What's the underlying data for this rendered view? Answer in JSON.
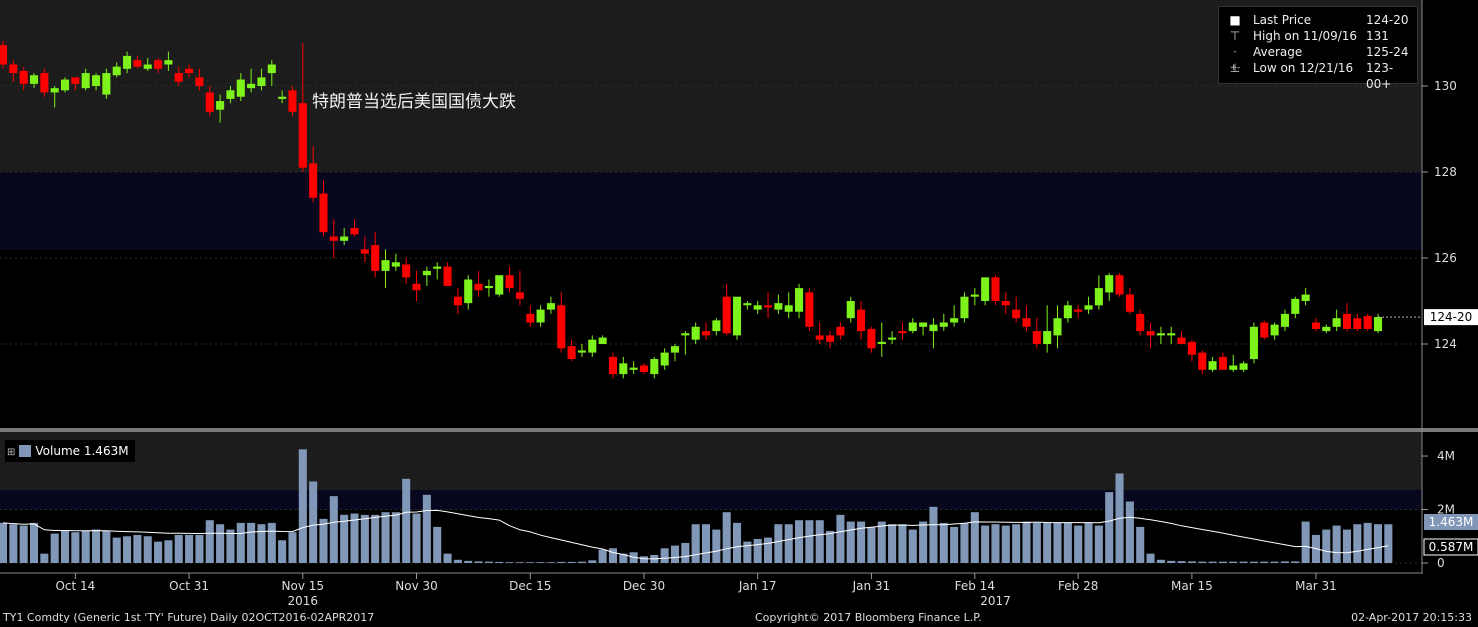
{
  "chart_data": [
    {
      "type": "candlestick",
      "instrument": "TY1 Comdty",
      "annotation": "特朗普当选后美国国债大跌",
      "ylim": [
        122,
        132
      ],
      "yticks": [
        124,
        126,
        128,
        130
      ],
      "ytick_labels": [
        "124",
        "126",
        "128",
        "130"
      ],
      "last_price_tag": "124-20",
      "last_price_value": 124.625,
      "legend": [
        {
          "symbol": "■",
          "label": "Last Price",
          "value": "124-20"
        },
        {
          "symbol": "⊤",
          "label": "High on 11/09/16",
          "value": "131"
        },
        {
          "symbol": "-+-",
          "label": "Average",
          "value": "125-24"
        },
        {
          "symbol": "⊥",
          "label": "Low on 12/21/16",
          "value": "123-00+"
        }
      ],
      "colors": {
        "up": "#7ef21b",
        "down": "#ff0000"
      },
      "candles": [
        [
          130.95,
          131.05,
          130.4,
          130.5
        ],
        [
          130.5,
          130.6,
          130.1,
          130.3
        ],
        [
          130.35,
          130.45,
          129.9,
          130.05
        ],
        [
          130.05,
          130.3,
          129.95,
          130.25
        ],
        [
          130.3,
          130.4,
          129.75,
          129.85
        ],
        [
          129.85,
          130.0,
          129.5,
          129.95
        ],
        [
          129.9,
          130.2,
          129.85,
          130.15
        ],
        [
          130.2,
          130.2,
          129.9,
          130.05
        ],
        [
          129.95,
          130.4,
          129.9,
          130.3
        ],
        [
          130.0,
          130.3,
          129.9,
          130.25
        ],
        [
          129.8,
          130.4,
          129.7,
          130.3
        ],
        [
          130.25,
          130.55,
          130.2,
          130.45
        ],
        [
          130.4,
          130.8,
          130.3,
          130.7
        ],
        [
          130.6,
          130.7,
          130.4,
          130.45
        ],
        [
          130.4,
          130.65,
          130.35,
          130.5
        ],
        [
          130.6,
          130.65,
          130.3,
          130.4
        ],
        [
          130.5,
          130.8,
          130.35,
          130.6
        ],
        [
          130.3,
          130.45,
          130.0,
          130.1
        ],
        [
          130.4,
          130.5,
          130.2,
          130.3
        ],
        [
          130.2,
          130.4,
          129.9,
          130.0
        ],
        [
          129.85,
          130.0,
          129.3,
          129.4
        ],
        [
          129.45,
          129.8,
          129.15,
          129.65
        ],
        [
          129.7,
          130.0,
          129.6,
          129.9
        ],
        [
          129.75,
          130.3,
          129.65,
          130.15
        ],
        [
          129.95,
          130.4,
          129.85,
          130.05
        ],
        [
          130.0,
          130.4,
          129.9,
          130.2
        ],
        [
          130.3,
          130.6,
          130.0,
          130.5
        ],
        [
          129.7,
          129.9,
          129.6,
          129.75
        ],
        [
          129.9,
          130.0,
          129.3,
          129.4
        ],
        [
          129.6,
          131.0,
          128.0,
          128.1
        ],
        [
          128.2,
          128.6,
          127.3,
          127.4
        ],
        [
          127.5,
          127.8,
          126.5,
          126.6
        ],
        [
          126.5,
          126.9,
          126.0,
          126.4
        ],
        [
          126.4,
          126.7,
          126.3,
          126.5
        ],
        [
          126.7,
          126.9,
          126.5,
          126.55
        ],
        [
          126.2,
          126.5,
          125.9,
          126.1
        ],
        [
          126.3,
          126.6,
          125.55,
          125.7
        ],
        [
          125.7,
          126.2,
          125.3,
          125.95
        ],
        [
          125.8,
          126.1,
          125.7,
          125.9
        ],
        [
          125.85,
          126.0,
          125.4,
          125.55
        ],
        [
          125.4,
          125.7,
          125.0,
          125.25
        ],
        [
          125.6,
          125.8,
          125.35,
          125.7
        ],
        [
          125.75,
          125.9,
          125.5,
          125.8
        ],
        [
          125.8,
          125.9,
          125.35,
          125.35
        ],
        [
          125.1,
          125.3,
          124.7,
          124.9
        ],
        [
          124.95,
          125.6,
          124.8,
          125.5
        ],
        [
          125.4,
          125.7,
          125.1,
          125.25
        ],
        [
          125.3,
          125.5,
          125.1,
          125.35
        ],
        [
          125.15,
          125.5,
          125.1,
          125.6
        ],
        [
          125.6,
          125.8,
          125.2,
          125.3
        ],
        [
          125.2,
          125.7,
          124.9,
          125.05
        ],
        [
          124.7,
          124.9,
          124.4,
          124.5
        ],
        [
          124.5,
          124.9,
          124.4,
          124.8
        ],
        [
          124.8,
          125.1,
          124.7,
          124.95
        ],
        [
          124.9,
          125.2,
          123.8,
          123.9
        ],
        [
          123.95,
          124.1,
          123.6,
          123.65
        ],
        [
          123.8,
          124.0,
          123.7,
          123.85
        ],
        [
          123.8,
          124.2,
          123.7,
          124.1
        ],
        [
          124.0,
          124.2,
          124.0,
          124.15
        ],
        [
          123.7,
          123.8,
          123.2,
          123.3
        ],
        [
          123.3,
          123.7,
          123.2,
          123.55
        ],
        [
          123.4,
          123.6,
          123.3,
          123.45
        ],
        [
          123.5,
          123.55,
          123.3,
          123.35
        ],
        [
          123.3,
          123.7,
          123.2,
          123.65
        ],
        [
          123.5,
          123.9,
          123.4,
          123.8
        ],
        [
          123.8,
          124.0,
          123.6,
          123.95
        ],
        [
          124.2,
          124.3,
          123.75,
          124.25
        ],
        [
          124.1,
          124.5,
          124.0,
          124.4
        ],
        [
          124.3,
          124.5,
          124.1,
          124.2
        ],
        [
          124.3,
          124.6,
          124.2,
          124.55
        ],
        [
          125.1,
          125.4,
          124.2,
          124.25
        ],
        [
          124.2,
          125.0,
          124.1,
          125.1
        ],
        [
          124.9,
          125.0,
          124.8,
          124.95
        ],
        [
          124.8,
          125.0,
          124.7,
          124.9
        ],
        [
          124.9,
          125.2,
          124.6,
          124.85
        ],
        [
          124.8,
          125.15,
          124.7,
          124.95
        ],
        [
          124.75,
          125.2,
          124.6,
          124.9
        ],
        [
          124.75,
          125.4,
          124.6,
          125.3
        ],
        [
          125.2,
          125.3,
          124.3,
          124.4
        ],
        [
          124.2,
          124.5,
          124.0,
          124.1
        ],
        [
          124.2,
          124.3,
          123.9,
          124.05
        ],
        [
          124.4,
          124.5,
          124.1,
          124.2
        ],
        [
          124.6,
          125.1,
          124.5,
          125.0
        ],
        [
          124.8,
          125.0,
          124.1,
          124.3
        ],
        [
          124.35,
          124.4,
          123.8,
          123.9
        ],
        [
          124.0,
          124.5,
          123.7,
          124.05
        ],
        [
          124.1,
          124.3,
          124.0,
          124.15
        ],
        [
          124.3,
          124.5,
          124.1,
          124.25
        ],
        [
          124.3,
          124.6,
          124.25,
          124.5
        ],
        [
          124.4,
          124.5,
          124.2,
          124.5
        ],
        [
          124.3,
          124.6,
          123.9,
          124.45
        ],
        [
          124.4,
          124.7,
          124.3,
          124.5
        ],
        [
          124.5,
          124.9,
          124.4,
          124.6
        ],
        [
          124.6,
          125.2,
          124.5,
          125.1
        ],
        [
          125.1,
          125.3,
          124.9,
          125.15
        ],
        [
          125.0,
          125.5,
          124.9,
          125.55
        ],
        [
          125.55,
          125.6,
          124.9,
          125.0
        ],
        [
          125.0,
          125.2,
          124.7,
          124.9
        ],
        [
          124.8,
          125.1,
          124.5,
          124.6
        ],
        [
          124.6,
          124.9,
          124.3,
          124.4
        ],
        [
          124.3,
          124.6,
          123.9,
          124.0
        ],
        [
          124.0,
          124.9,
          123.8,
          124.3
        ],
        [
          124.2,
          124.9,
          123.9,
          124.6
        ],
        [
          124.6,
          125.0,
          124.5,
          124.9
        ],
        [
          124.8,
          124.9,
          124.6,
          124.75
        ],
        [
          124.8,
          125.1,
          124.7,
          124.9
        ],
        [
          124.9,
          125.6,
          124.8,
          125.3
        ],
        [
          125.2,
          125.65,
          125.0,
          125.6
        ],
        [
          125.6,
          125.65,
          125.1,
          125.15
        ],
        [
          125.15,
          125.3,
          124.7,
          124.75
        ],
        [
          124.7,
          124.8,
          124.2,
          124.3
        ],
        [
          124.3,
          124.5,
          123.9,
          124.2
        ],
        [
          124.2,
          124.4,
          124.0,
          124.25
        ],
        [
          124.2,
          124.4,
          124.0,
          124.25
        ],
        [
          124.15,
          124.3,
          124.0,
          124.0
        ],
        [
          124.05,
          124.1,
          123.6,
          123.75
        ],
        [
          123.8,
          123.85,
          123.3,
          123.4
        ],
        [
          123.4,
          123.7,
          123.35,
          123.6
        ],
        [
          123.7,
          123.8,
          123.4,
          123.4
        ],
        [
          123.4,
          123.75,
          123.35,
          123.5
        ],
        [
          123.4,
          123.6,
          123.35,
          123.55
        ],
        [
          123.65,
          124.5,
          123.55,
          124.4
        ],
        [
          124.5,
          124.55,
          124.1,
          124.15
        ],
        [
          124.2,
          124.5,
          124.1,
          124.45
        ],
        [
          124.4,
          124.8,
          124.3,
          124.7
        ],
        [
          124.7,
          125.1,
          124.6,
          125.05
        ],
        [
          125.0,
          125.3,
          124.9,
          125.15
        ],
        [
          124.5,
          124.6,
          124.3,
          124.35
        ],
        [
          124.3,
          124.45,
          124.25,
          124.4
        ],
        [
          124.4,
          124.8,
          124.3,
          124.6
        ],
        [
          124.7,
          124.95,
          124.3,
          124.35
        ],
        [
          124.6,
          124.7,
          124.3,
          124.35
        ],
        [
          124.65,
          124.7,
          124.3,
          124.35
        ],
        [
          124.3,
          124.7,
          124.25,
          124.625
        ]
      ]
    },
    {
      "type": "bar",
      "series_name": "Volume",
      "legend_label": "Volume",
      "legend_value": "1.463M",
      "average_tag": "0.587M",
      "ylim": [
        0,
        4.6
      ],
      "yticks": [
        0,
        2,
        4
      ],
      "ytick_labels": [
        "0",
        "2M",
        "4M"
      ],
      "colors": {
        "bar": "#8097b8",
        "average": "#ffffff"
      },
      "volume_millions": [
        1.5,
        1.45,
        1.4,
        1.5,
        0.35,
        1.1,
        1.2,
        1.15,
        1.2,
        1.25,
        1.2,
        0.95,
        1.0,
        1.05,
        1.0,
        0.8,
        0.85,
        1.05,
        1.05,
        1.05,
        1.6,
        1.45,
        1.25,
        1.5,
        1.5,
        1.45,
        1.5,
        0.85,
        1.15,
        4.25,
        3.05,
        1.65,
        2.5,
        1.8,
        1.85,
        1.8,
        1.8,
        1.9,
        1.9,
        3.15,
        1.85,
        2.55,
        1.35,
        0.35,
        0.12,
        0.08,
        0.06,
        0.05,
        0.04,
        0.03,
        0.03,
        0.03,
        0.03,
        0.03,
        0.04,
        0.04,
        0.05,
        0.1,
        0.5,
        0.55,
        0.35,
        0.4,
        0.25,
        0.3,
        0.55,
        0.65,
        0.75,
        1.45,
        1.45,
        1.25,
        1.9,
        1.5,
        0.8,
        0.9,
        0.95,
        1.45,
        1.45,
        1.6,
        1.6,
        1.6,
        1.2,
        1.8,
        1.55,
        1.55,
        1.35,
        1.55,
        1.45,
        1.45,
        1.25,
        1.55,
        2.1,
        1.5,
        1.35,
        1.5,
        1.9,
        1.4,
        1.45,
        1.4,
        1.45,
        1.55,
        1.5,
        1.5,
        1.5,
        1.5,
        1.4,
        1.5,
        1.4,
        2.65,
        3.35,
        2.3,
        1.35,
        0.35,
        0.12,
        0.08,
        0.07,
        0.06,
        0.05,
        0.05,
        0.05,
        0.05,
        0.05,
        0.05,
        0.05,
        0.05,
        0.06,
        0.06,
        1.55,
        1.05,
        1.25,
        1.4,
        1.25,
        1.45,
        1.5,
        1.45,
        1.45
      ]
    }
  ],
  "x_axis": {
    "date_labels": [
      {
        "label": "Oct 14",
        "index": 7
      },
      {
        "label": "Oct 31",
        "index": 18
      },
      {
        "label": "Nov 15",
        "index": 29
      },
      {
        "label": "Nov 30",
        "index": 40
      },
      {
        "label": "Dec 15",
        "index": 51
      },
      {
        "label": "Dec 30",
        "index": 62
      },
      {
        "label": "Jan 17",
        "index": 73
      },
      {
        "label": "Jan 31",
        "index": 84
      },
      {
        "label": "Feb 14",
        "index": 94
      },
      {
        "label": "Feb 28",
        "index": 104
      },
      {
        "label": "Mar 15",
        "index": 115
      },
      {
        "label": "Mar 31",
        "index": 127
      }
    ],
    "year_labels": [
      {
        "label": "2016",
        "index": 29
      },
      {
        "label": "2017",
        "index": 96
      }
    ]
  },
  "footer": {
    "left": "TY1 Comdty (Generic 1st 'TY' Future)  Daily 02OCT2016-02APR2017",
    "center": "Copyright© 2017 Bloomberg Finance L.P.",
    "right": "02-Apr-2017 20:15:33"
  }
}
